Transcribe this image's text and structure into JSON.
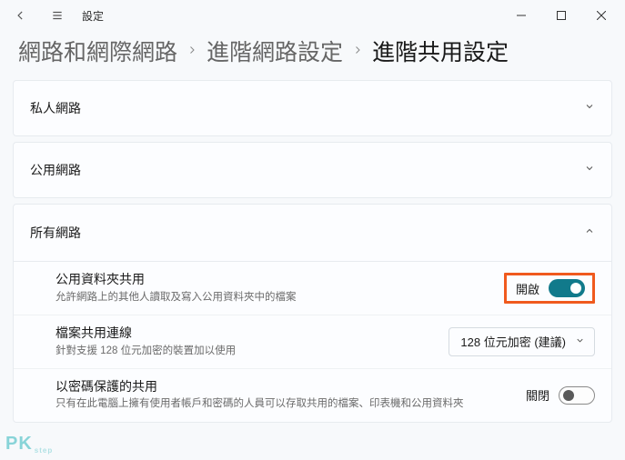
{
  "window": {
    "app_name": "設定"
  },
  "breadcrumb": {
    "level1": "網路和網際網路",
    "level2": "進階網路設定",
    "level3": "進階共用設定"
  },
  "sections": {
    "private": {
      "label": "私人網路"
    },
    "public": {
      "label": "公用網路"
    },
    "all": {
      "label": "所有網路"
    }
  },
  "all_networks": {
    "public_folder": {
      "title": "公用資料夾共用",
      "desc": "允許網路上的其他人讀取及寫入公用資料夾中的檔案",
      "state_label": "開啟"
    },
    "file_share_conn": {
      "title": "檔案共用連線",
      "desc": "針對支援 128 位元加密的裝置加以使用",
      "dropdown_value": "128 位元加密 (建議)"
    },
    "password_protected": {
      "title": "以密碼保護的共用",
      "desc": "只有在此電腦上擁有使用者帳戶和密碼的人員可以存取共用的檔案、印表機和公用資料夾",
      "state_label": "關閉"
    }
  },
  "watermark": {
    "main": "PK",
    "sub": "step"
  }
}
